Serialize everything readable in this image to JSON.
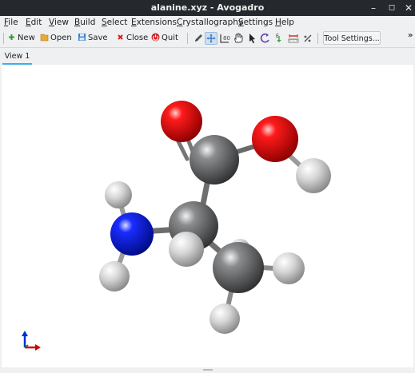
{
  "window": {
    "title": "alanine.xyz - Avogadro"
  },
  "window_controls": {
    "minimize": "–",
    "maximize": "◻",
    "close": "✕"
  },
  "menu": [
    {
      "label": "File",
      "mnemonic": "F",
      "rest": "ile"
    },
    {
      "label": "Edit",
      "mnemonic": "E",
      "rest": "dit"
    },
    {
      "label": "View",
      "mnemonic": "V",
      "rest": "iew"
    },
    {
      "label": "Build",
      "mnemonic": "B",
      "rest": "uild"
    },
    {
      "label": "Select",
      "mnemonic": "S",
      "rest": "elect"
    },
    {
      "label": "Extensions",
      "mnemonic": "E",
      "rest": "xtensions"
    },
    {
      "label": "Crystallography",
      "mnemonic": "C",
      "rest": "rystallography"
    },
    {
      "label": "Settings",
      "mnemonic": "S",
      "rest": "ettings"
    },
    {
      "label": "Help",
      "mnemonic": "H",
      "rest": "elp"
    }
  ],
  "toolbar": {
    "new_label": "New",
    "open_label": "Open",
    "save_label": "Save",
    "close_label": "Close",
    "quit_label": "Quit",
    "tool_settings_label": "Tool Settings...",
    "overflow_label": "»",
    "tools": [
      "draw-tool",
      "navigate-tool",
      "bond-centric-tool",
      "manipulate-tool",
      "select-tool",
      "auto-rotate-tool",
      "auto-optimization-tool",
      "measure-tool",
      "align-tool"
    ],
    "active_tool": "navigate-tool"
  },
  "tabs": [
    {
      "label": "View 1",
      "active": true
    }
  ],
  "colors": {
    "carbon": "#5a5c5e",
    "oxygen": "#e00000",
    "nitrogen": "#0010e0",
    "hydrogen": "#d8d8d8",
    "axis_x": "#d40000",
    "axis_z": "#0030d0",
    "tab_accent": "#3daee9"
  }
}
